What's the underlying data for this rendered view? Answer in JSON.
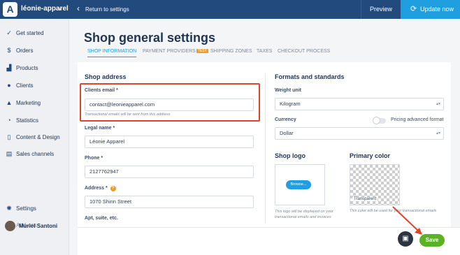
{
  "topbar": {
    "logo_letter": "A",
    "store_name": "léonie-apparel",
    "store_chevron": "⌄",
    "back_chevron": "‹",
    "back_label": "Return to settings",
    "preview_label": "Preview",
    "update_icon": "⟳",
    "update_label": "Update now",
    "background": "#234a7c",
    "accent": "#1f9fe0"
  },
  "sidebar": {
    "items": [
      {
        "label": "Get started",
        "icon": "check-circle-icon",
        "glyph": "✓"
      },
      {
        "label": "Orders",
        "icon": "dollar-icon",
        "glyph": "$"
      },
      {
        "label": "Products",
        "icon": "cart-icon",
        "glyph": "▟"
      },
      {
        "label": "Clients",
        "icon": "people-icon",
        "glyph": "●"
      },
      {
        "label": "Marketing",
        "icon": "bell-icon",
        "glyph": "▲"
      },
      {
        "label": "Statistics",
        "icon": "pie-icon",
        "glyph": "◔"
      },
      {
        "label": "Content & Design",
        "icon": "phone-icon",
        "glyph": "▯"
      },
      {
        "label": "Sales channels",
        "icon": "store-icon",
        "glyph": "▤"
      }
    ],
    "footer_items": [
      {
        "label": "Settings",
        "icon": "gear-icon",
        "glyph": "✺"
      },
      {
        "label": "Add-ons",
        "icon": "plus-icon",
        "glyph": "+"
      }
    ],
    "user_name": "Muriel Santoni"
  },
  "main": {
    "title": "Shop general settings",
    "tabs": [
      {
        "label": "SHOP INFORMATION",
        "active": true
      },
      {
        "label": "PAYMENT PROVIDERS",
        "badge": "TEST"
      },
      {
        "label": "SHIPPING ZONES"
      },
      {
        "label": "TAXES"
      },
      {
        "label": "CHECKOUT PROCESS"
      }
    ],
    "shop_address": {
      "title": "Shop address",
      "clients_email_label": "Clients email *",
      "clients_email_value": "contact@leonieapparel.com",
      "clients_email_help": "Transactional emails will be sent from this address",
      "legal_name_label": "Legal name *",
      "legal_name_value": "Léonie Apparel",
      "phone_label": "Phone *",
      "phone_value": "2127762947",
      "address_label": "Address *",
      "address_help_icon": "?",
      "address_value": "1070  Shinn Street",
      "apt_label": "Apt, suite, etc."
    },
    "formats": {
      "title": "Formats and standards",
      "weight_label": "Weight unit",
      "weight_value": "Kilogram",
      "currency_label": "Currency",
      "currency_value": "Dollar",
      "pricing_advanced_label": "Pricing advanced format",
      "pricing_advanced_on": false,
      "caret": "▴▾"
    },
    "shop_logo": {
      "title": "Shop logo",
      "browse_label": "Browse...",
      "help": "This logo will be displayed on your transactional emails and invoices"
    },
    "primary_color": {
      "title": "Primary color",
      "value_label": "Transparent",
      "help": "This color will be used for your transactional emails"
    }
  },
  "footer": {
    "chat_icon": "chat-icon",
    "chat_glyph": "▣",
    "save_label": "Save",
    "save_color": "#5bb324"
  },
  "annotations": {
    "highlight_color": "#e0452b"
  }
}
